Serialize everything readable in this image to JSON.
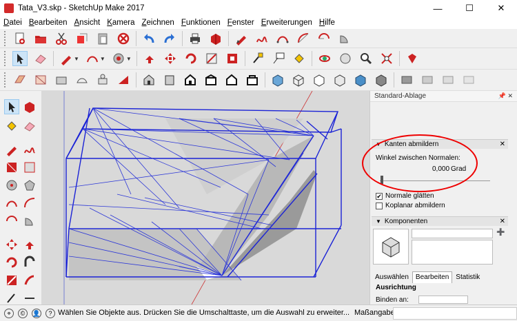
{
  "window": {
    "title": "Tata_V3.skp - SketchUp Make 2017",
    "minimize": "—",
    "maximize": "☐",
    "close": "✕"
  },
  "menu": [
    "Datei",
    "Bearbeiten",
    "Ansicht",
    "Kamera",
    "Zeichnen",
    "Funktionen",
    "Fenster",
    "Erweiterungen",
    "Hilfe"
  ],
  "toolbar_icons": {
    "row1": [
      "new-file-icon",
      "open-folder-icon",
      "cut-icon",
      "copy-icon",
      "paste-icon",
      "delete-icon",
      "undo-icon",
      "redo-icon",
      "print-icon",
      "model-info-icon",
      "pencil-icon",
      "freehand-icon",
      "arc-icon",
      "two-point-arc-icon",
      "three-point-arc-icon",
      "pie-icon"
    ],
    "row2": [
      "select-icon",
      "eraser-icon",
      "line-icon",
      "arc-tool-icon",
      "shape-icon",
      "push-pull-icon",
      "move-icon",
      "rotate-icon",
      "scale-icon",
      "offset-icon",
      "tape-measure-icon",
      "text-icon",
      "paint-bucket-icon",
      "orbit-icon",
      "pan-icon",
      "zoom-icon",
      "zoom-extents-icon",
      "ruby-icon"
    ],
    "row3": [
      "views-iso-icon",
      "views-top-icon",
      "views-front-icon",
      "views-right-icon",
      "views-back-icon",
      "views-left-icon",
      "xray-icon",
      "wireframe-icon",
      "hidden-line-icon",
      "shaded-icon",
      "shaded-texture-icon",
      "monochrome-icon"
    ]
  },
  "tray": {
    "title": "Standard-Ablage",
    "soften_panel": {
      "header": "Kanten abmildern",
      "angle_label": "Winkel zwischen Normalen:",
      "angle_value": "0,000",
      "angle_unit": "Grad",
      "smooth_normals": "Normale glätten",
      "smooth_checked": "✔",
      "soften_coplanar": "Koplanar abmildern"
    },
    "components_panel": {
      "header": "Komponenten",
      "tabs": [
        "Auswählen",
        "Bearbeiten",
        "Statistik"
      ],
      "section_title": "Ausrichtung",
      "row_label": "Binden an:"
    }
  },
  "statusbar": {
    "message": "Wählen Sie Objekte aus. Drücken Sie die Umschalttaste, um die Auswahl zu erweiter...",
    "measurements_label": "Maßangaben",
    "measurements_value": ""
  }
}
